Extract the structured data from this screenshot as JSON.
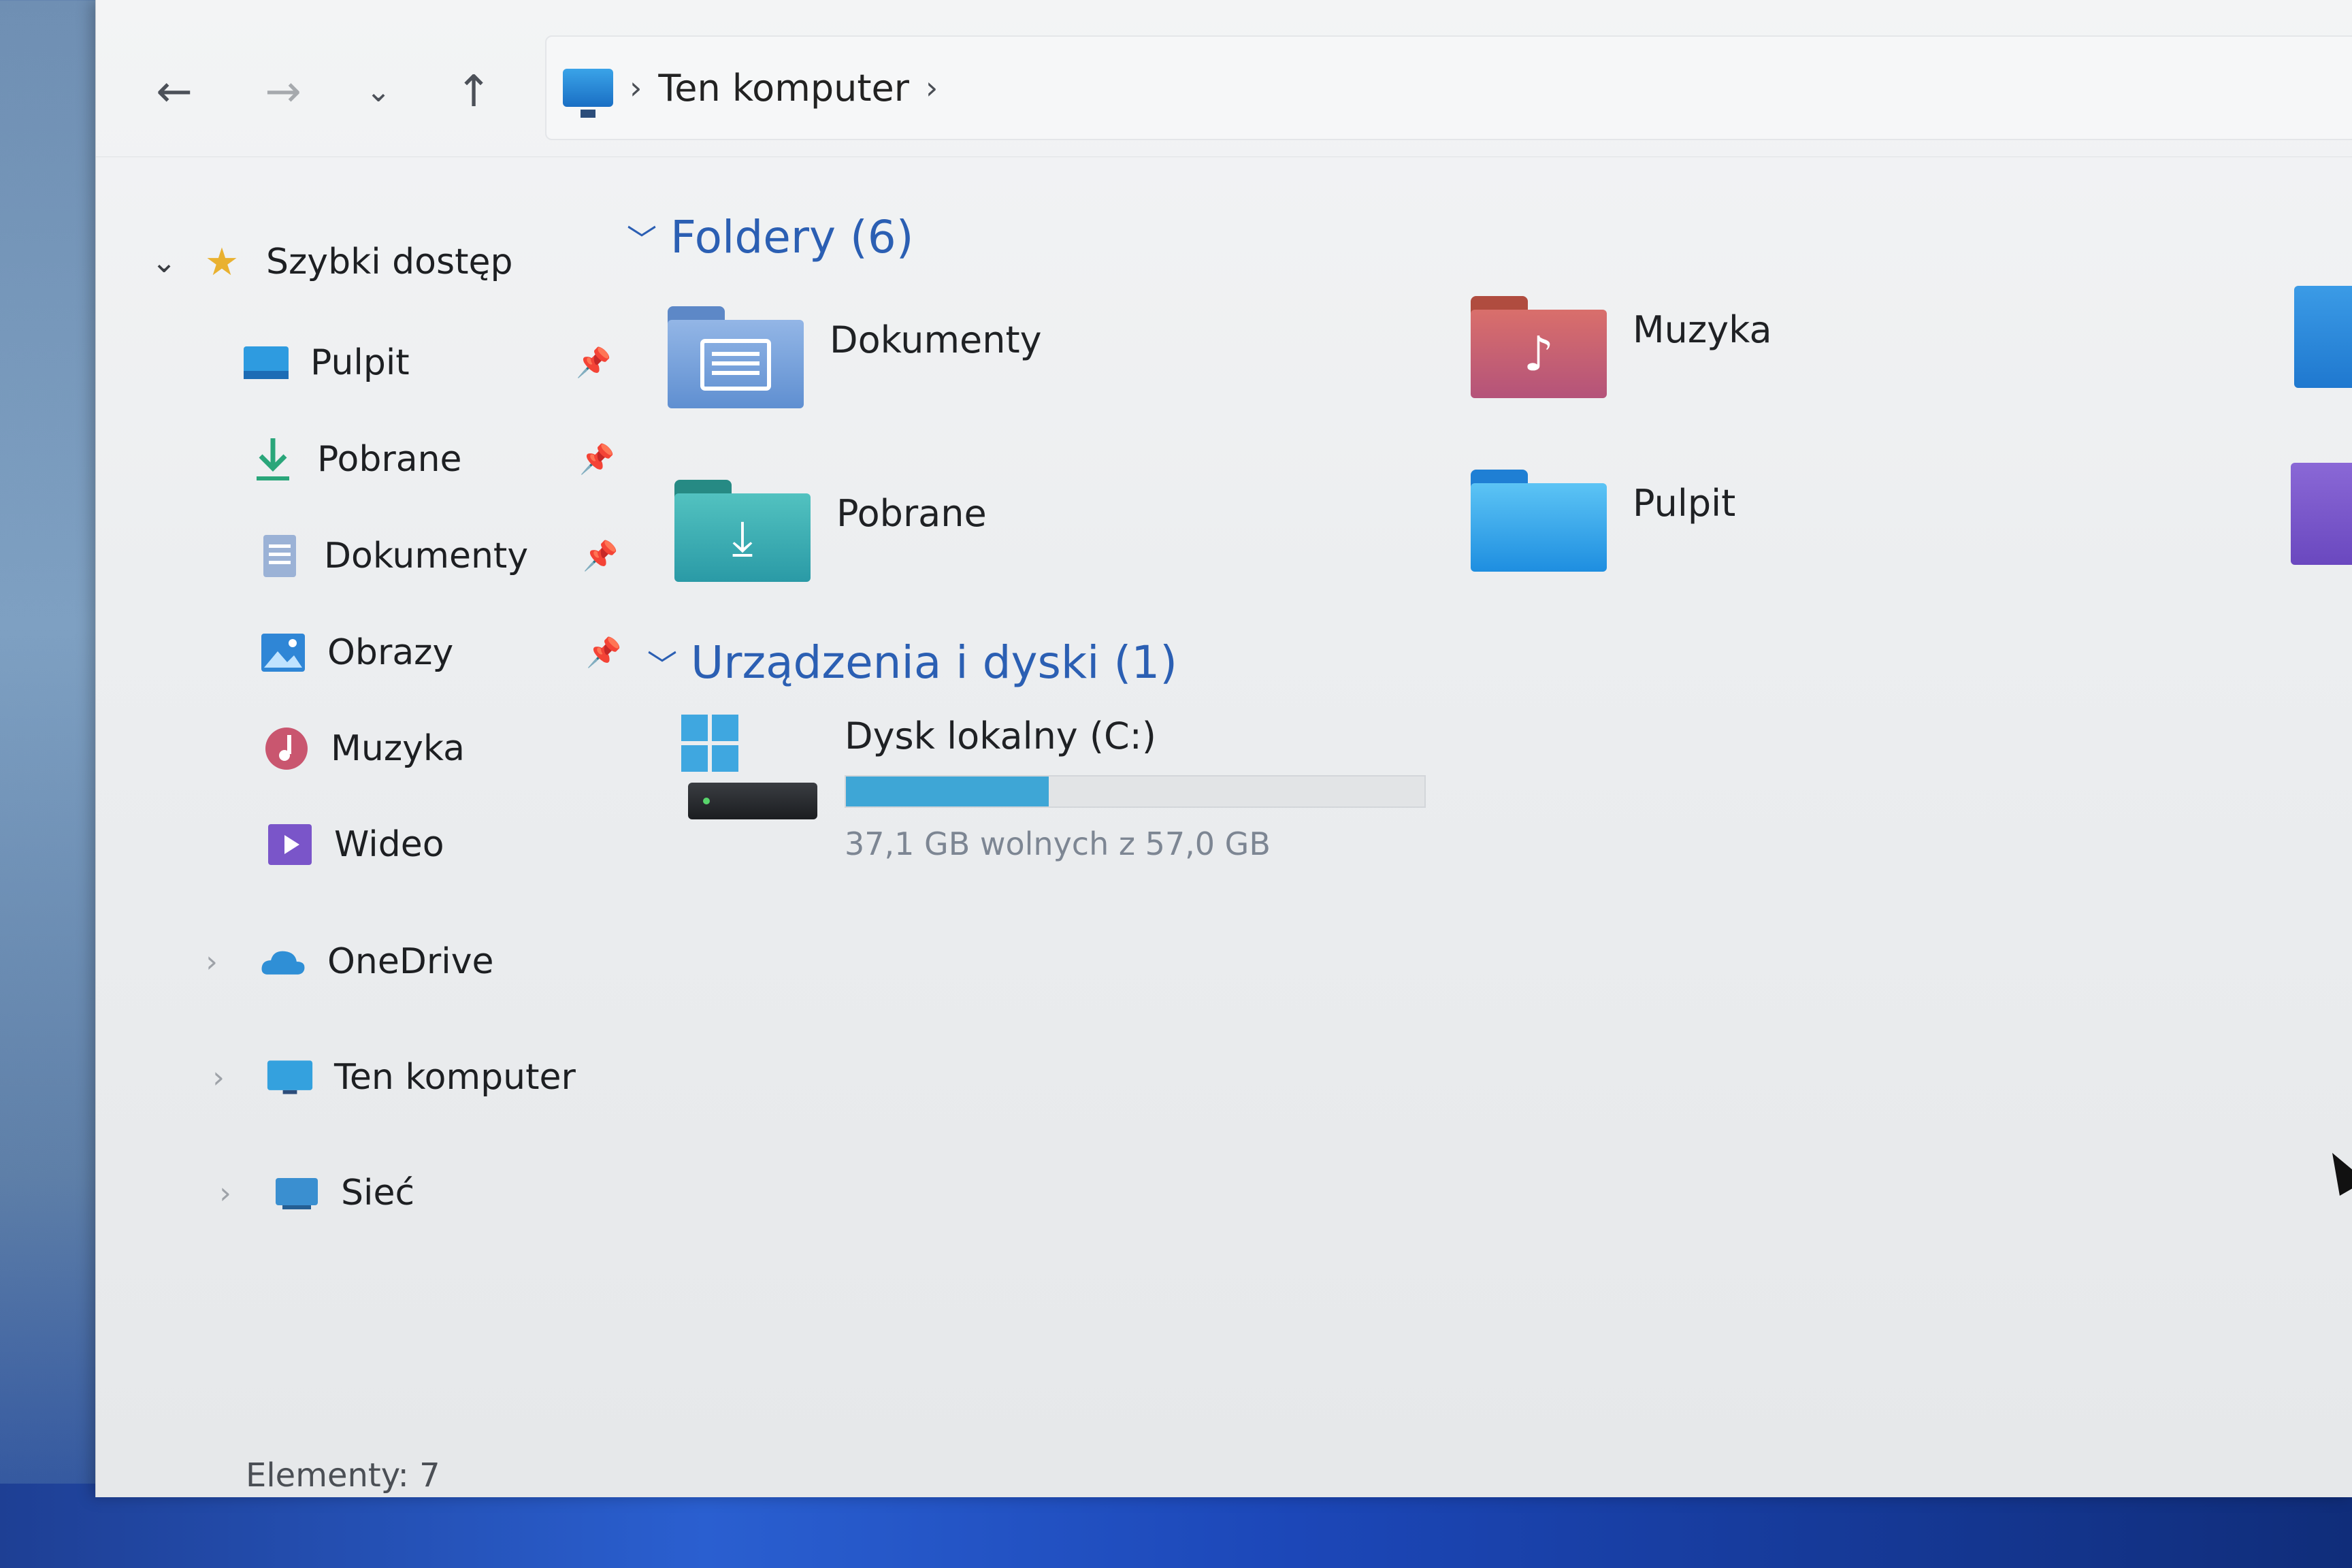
{
  "nav": {
    "back_icon": "←",
    "forward_icon": "→",
    "recent_icon": "⌄",
    "up_icon": "↑"
  },
  "address": {
    "icon": "computer-icon",
    "sep1": "›",
    "crumb": "Ten komputer",
    "sep2": "›"
  },
  "sidebar": {
    "quick_access": {
      "label": "Szybki dostęp",
      "chevron": "⌄",
      "icon": "★"
    },
    "items": [
      {
        "label": "Pulpit",
        "icon": "desktop-icon"
      },
      {
        "label": "Pobrane",
        "icon": "download-icon"
      },
      {
        "label": "Dokumenty",
        "icon": "documents-icon"
      },
      {
        "label": "Obrazy",
        "icon": "pictures-icon"
      },
      {
        "label": "Muzyka",
        "icon": "music-icon"
      },
      {
        "label": "Wideo",
        "icon": "video-icon"
      }
    ],
    "roots": [
      {
        "label": "OneDrive",
        "chevron": "›",
        "icon": "onedrive-icon"
      },
      {
        "label": "Ten komputer",
        "chevron": "›",
        "icon": "computer-icon"
      },
      {
        "label": "Sieć",
        "chevron": "›",
        "icon": "network-icon"
      }
    ]
  },
  "content": {
    "folders_header": "Foldery (6)",
    "folders": [
      {
        "label": "Dokumenty",
        "icon": "documents-folder-icon"
      },
      {
        "label": "Muzyka",
        "icon": "music-folder-icon"
      },
      {
        "label": "Pobrane",
        "icon": "downloads-folder-icon"
      },
      {
        "label": "Pulpit",
        "icon": "desktop-folder-icon"
      }
    ],
    "devices_header": "Urządzenia i dyski (1)",
    "drive": {
      "name": "Dysk lokalny (C:)",
      "free_text": "37,1 GB wolnych z 57,0 GB",
      "used_fraction": 0.35
    }
  },
  "status": {
    "text": "Elementy: 7"
  },
  "colors": {
    "accent": "#2b5fb3",
    "drive_bar": "#3ea6d6"
  }
}
